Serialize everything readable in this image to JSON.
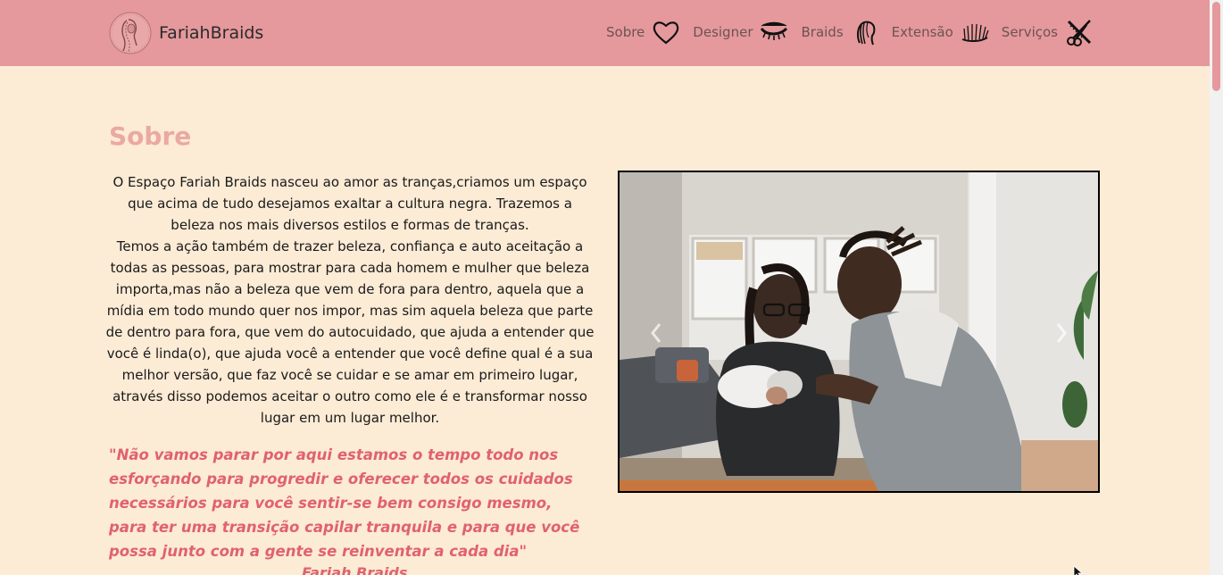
{
  "header": {
    "brand_name": "FariahBraids",
    "nav": [
      {
        "label": "Sobre",
        "icon": "heart-icon"
      },
      {
        "label": "Designer",
        "icon": "eyelash-icon"
      },
      {
        "label": "Braids",
        "icon": "braided-head-icon"
      },
      {
        "label": "Extensão",
        "icon": "lash-extension-icon"
      },
      {
        "label": "Serviços",
        "icon": "scissors-comb-icon"
      }
    ]
  },
  "about": {
    "title": "Sobre",
    "paragraph_1": "O Espaço Fariah Braids nasceu ao amor as tranças,criamos um espaço que acima de tudo desejamos exaltar a cultura negra. Trazemos a beleza nos mais diversos estilos e formas de tranças.",
    "paragraph_2": "Temos a ação também de trazer beleza, confiança e auto aceitação a todas as pessoas, para mostrar para cada homem e mulher que beleza importa,mas não a beleza que vem de fora para dentro, aquela que a mídia em todo mundo quer nos impor, mas sim aquela beleza que parte de dentro para fora, que vem do autocuidado, que ajuda a entender que você é linda(o), que ajuda você a entender que você define qual é a sua melhor versão, que faz você se cuidar e se amar em primeiro lugar, através disso podemos aceitar o outro como ele é e transformar nosso lugar em um lugar melhor.",
    "quote": "\"Não vamos parar por aqui estamos o tempo todo nos esforçando para progredir e oferecer todos os cuidados necessários para você sentir-se bem consigo mesmo, para ter uma transição capilar tranquila e para que você possa junto com a gente se reinventar a cada dia\"",
    "signature": "Fariah Braids"
  },
  "carousel": {
    "prev_icon": "chevron-left-icon",
    "next_icon": "chevron-right-icon"
  },
  "colors": {
    "header_bg": "#e5999c",
    "page_bg": "#fcebd5",
    "title": "#eaa9a2",
    "quote": "#e0626e"
  }
}
